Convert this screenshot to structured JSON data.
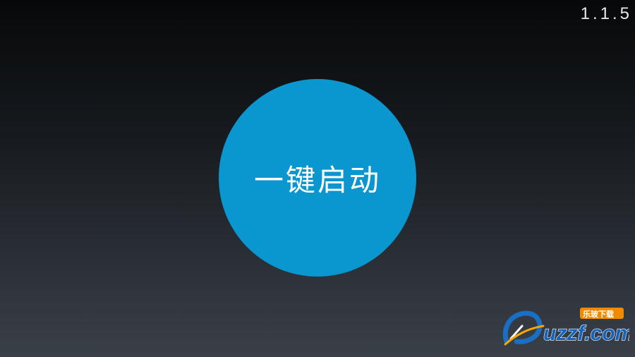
{
  "app": {
    "version": "1.1.5"
  },
  "main": {
    "launch_button_label": "一键启动",
    "button_color": "#0a96ce"
  },
  "watermark": {
    "logo_text": "uzzf.com",
    "tagline": "乐玻下载",
    "icon": "uzzf-logo-icon"
  }
}
